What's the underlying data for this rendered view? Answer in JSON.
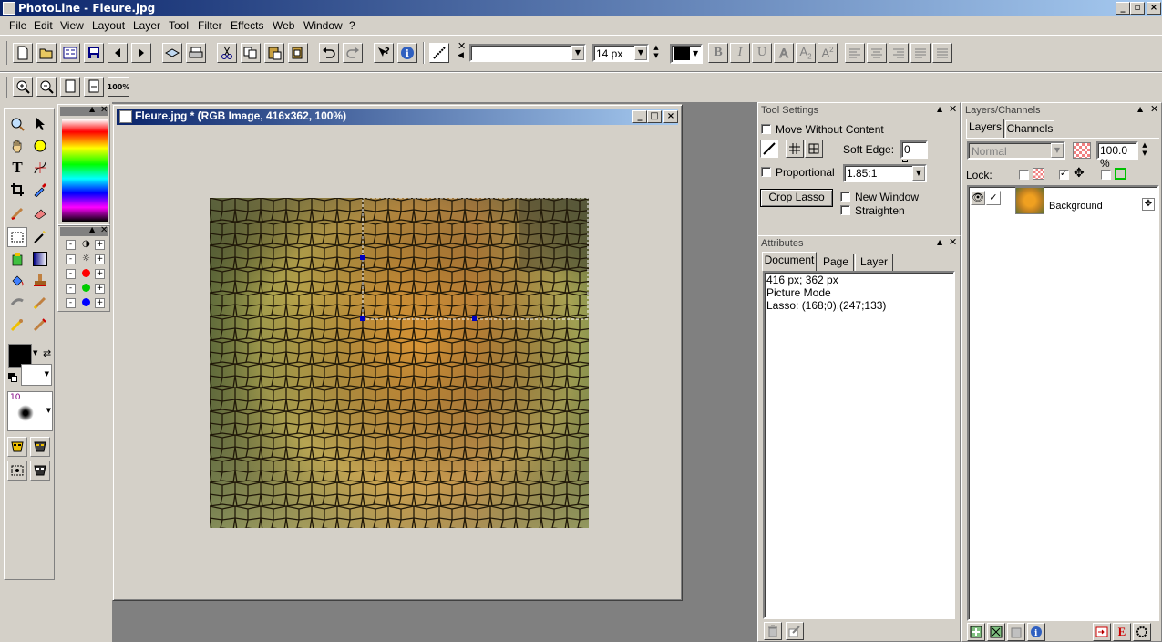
{
  "app": {
    "title": "PhotoLine - Fleure.jpg"
  },
  "menu": [
    "File",
    "Edit",
    "View",
    "Layout",
    "Layer",
    "Tool",
    "Filter",
    "Effects",
    "Web",
    "Window",
    "?"
  ],
  "toolbar": {
    "font_name": "",
    "font_size": "14 px",
    "zoom_100_label": "100%"
  },
  "document": {
    "title": "Fleure.jpg * (RGB Image, 416x362, 100%)"
  },
  "tool_settings": {
    "title": "Tool Settings",
    "move_without_content": "Move Without Content",
    "soft_edge_label": "Soft Edge:",
    "soft_edge_value": "0",
    "proportional": "Proportional",
    "ratio": "1.85:1",
    "crop_button": "Crop Lasso",
    "new_window": "New Window",
    "straighten": "Straighten"
  },
  "attributes": {
    "title": "Attributes",
    "tabs": [
      "Document",
      "Page",
      "Layer"
    ],
    "lines": [
      "416 px; 362 px",
      "Picture Mode",
      "Lasso: (168;0),(247;133)"
    ]
  },
  "layers": {
    "title": "Layers/Channels",
    "tabs": [
      "Layers",
      "Channels"
    ],
    "blend_mode": "Normal",
    "opacity": "100.0 %",
    "lock_label": "Lock:",
    "items": [
      {
        "name": "Background"
      }
    ]
  },
  "brush": {
    "size": "10"
  },
  "colors": {
    "accent": "#0a246a",
    "canvas_bg": "#808080",
    "panel_bg": "#d4d0c8"
  }
}
